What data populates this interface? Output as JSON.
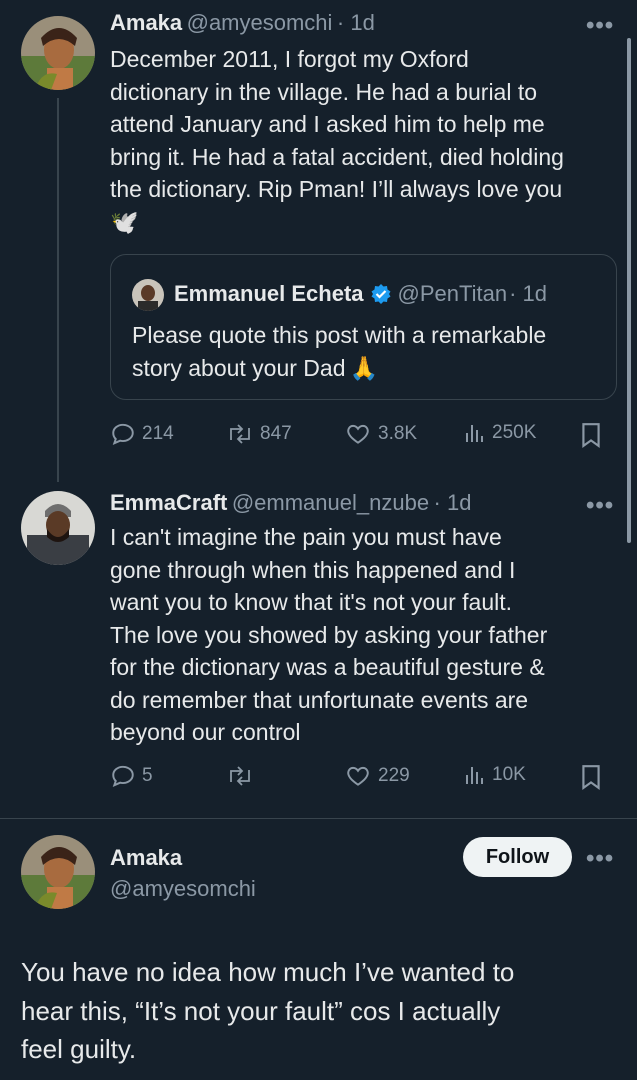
{
  "post1": {
    "name": "Amaka",
    "handle": "@amyesomchi",
    "time": "· 1d",
    "lines": [
      "December 2011, I forgot my Oxford",
      "dictionary in the village. He had a burial to",
      "attend January and I asked him to help me",
      "bring it. He had a fatal accident, died holding",
      "the dictionary. Rip Pman! I’ll always love you"
    ],
    "emoji": "🕊️",
    "quote": {
      "name": "Emmanuel Echeta",
      "handle": "@PenTitan",
      "time": "· 1d",
      "line1": "Please quote this post with a remarkable",
      "line2": "story about your Dad",
      "emoji": "🙏"
    },
    "stats": {
      "replies": "214",
      "reposts": "847",
      "likes": "3.8K",
      "views": "250K"
    }
  },
  "post2": {
    "name": "EmmaCraft",
    "handle": "@emmanuel_nzube",
    "time": "· 1d",
    "lines": [
      "I can't imagine the pain you must have",
      "gone through when this happened and I",
      "want you to know that it's not your fault.",
      "The love you showed by asking your father",
      "for the dictionary was a beautiful gesture &",
      "do remember that unfortunate events are",
      "beyond our control"
    ],
    "stats": {
      "replies": "5",
      "reposts": "",
      "likes": "229",
      "views": "10K"
    }
  },
  "post3": {
    "name": "Amaka",
    "handle": "@amyesomchi",
    "follow_label": "Follow",
    "lines": [
      "You have no idea how much I’ve wanted to",
      "hear this, “It’s not your fault” cos I actually",
      "feel guilty."
    ]
  },
  "more_label": "•••",
  "colors": {
    "background": "#15202b",
    "text": "#e7e9ea",
    "muted": "#8b98a5",
    "verified": "#1d9bf0",
    "border": "#38444d"
  }
}
